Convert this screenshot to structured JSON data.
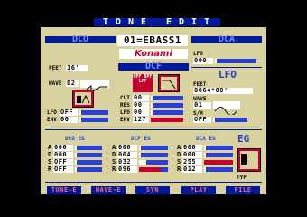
{
  "title": "TONE EDIT",
  "voice_name": "01=EBASS1",
  "brand": "Konami",
  "dco": {
    "header": "DCO",
    "feet_label": "FEET",
    "feet_value": "16'",
    "wave_label": "WAVE",
    "wave_value": "02",
    "lfo_label": "LFO",
    "lfo_value": "OFF",
    "env_label": "ENV",
    "env_value": "00"
  },
  "dcf": {
    "header": "DCF",
    "filter_tag": "HPF BPF LPF",
    "rows": [
      {
        "label": "CUT",
        "value": "00",
        "level": 0.05
      },
      {
        "label": "RES",
        "value": "00",
        "level": 0.05
      },
      {
        "label": "LFO",
        "value": "00",
        "level": 0.05
      },
      {
        "label": "ENV",
        "value": "127",
        "level": 1.0
      }
    ]
  },
  "dca": {
    "header": "DCA",
    "lfo_label": "LFO",
    "lfo_value": "000"
  },
  "lfo": {
    "header": "LFO",
    "feet_label": "FEET",
    "feet_value": "0064*00'",
    "wave_label": "WAVE",
    "wave_value": "01",
    "sh_label": "S/H",
    "sh_value": "OFF"
  },
  "dco_eg": {
    "header": "DCO EG",
    "rows": [
      {
        "label": "A",
        "value": "000"
      },
      {
        "label": "D",
        "value": "000"
      },
      {
        "label": "S",
        "value": "OFF"
      },
      {
        "label": "R",
        "value": "OFF"
      }
    ]
  },
  "dcf_eg": {
    "header": "DCF EG",
    "rows": [
      {
        "label": "A",
        "value": "000",
        "level": 0.0
      },
      {
        "label": "D",
        "value": "004",
        "level": 0.04
      },
      {
        "label": "S",
        "value": "032",
        "level": 0.25
      },
      {
        "label": "R",
        "value": "096",
        "level": 0.75
      }
    ]
  },
  "dca_eg": {
    "header": "DCA EG",
    "rows": [
      {
        "label": "A",
        "value": "000",
        "level": 0.0
      },
      {
        "label": "D",
        "value": "000",
        "level": 0.0
      },
      {
        "label": "S",
        "value": "255",
        "level": 1.0
      },
      {
        "label": "R",
        "value": "012",
        "level": 0.05
      }
    ]
  },
  "eg": {
    "header": "EG",
    "typ_label": "TYP",
    "icon_text": "SUB DEC"
  },
  "menu": [
    "TONE-E",
    "WAVE-E",
    "SYN",
    "PLAY",
    "FILE"
  ],
  "colors": {
    "panel": "#d9d29e",
    "bar": "#001a9a",
    "accent_red": "#c6002a",
    "header_blue": "#1f3fd6"
  }
}
